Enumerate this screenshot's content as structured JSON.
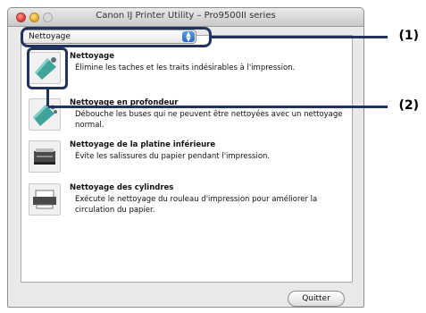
{
  "window": {
    "title": "Canon IJ Printer Utility – Pro9500II series"
  },
  "dropdown": {
    "selected": "Nettoyage"
  },
  "items": [
    {
      "title": "Nettoyage",
      "desc": "Élimine les taches et les traits indésirables à l'impression."
    },
    {
      "title": "Nettoyage en profondeur",
      "desc": "Débouche les buses qui ne peuvent être nettoyées avec un nettoyage normal."
    },
    {
      "title": "Nettoyage de la platine inférieure",
      "desc": "Évite les salissures du papier pendant l'impression."
    },
    {
      "title": "Nettoyage des cylindres",
      "desc": "Exécute le nettoyage du rouleau d'impression pour améliorer la circulation du papier."
    }
  ],
  "quit_label": "Quitter",
  "callouts": {
    "one": "(1)",
    "two": "(2)"
  },
  "colors": {
    "highlight": "#22335f",
    "icon_teal": "#3fa39a"
  }
}
